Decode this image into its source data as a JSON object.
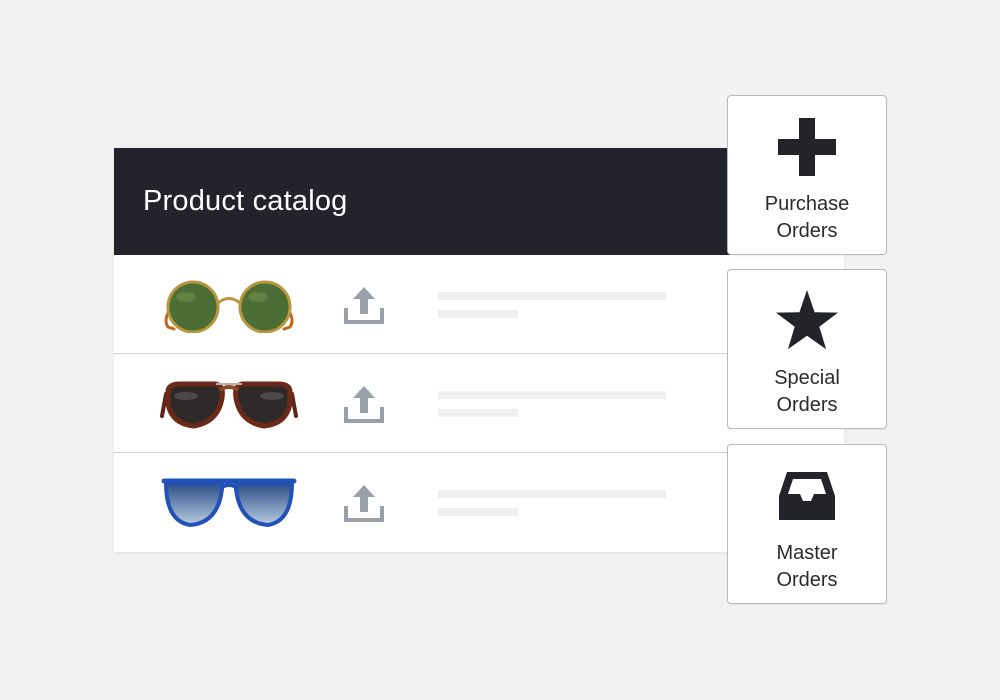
{
  "catalog": {
    "title": "Product catalog",
    "rows": [
      {
        "product_icon": "round-green-sunglasses-icon",
        "action_icon": "upload-icon"
      },
      {
        "product_icon": "tortoise-aviator-sunglasses-icon",
        "action_icon": "upload-icon"
      },
      {
        "product_icon": "blue-frame-sunglasses-icon",
        "action_icon": "upload-icon"
      }
    ]
  },
  "actions": [
    {
      "icon": "plus-icon",
      "label_line1": "Purchase",
      "label_line2": "Orders"
    },
    {
      "icon": "star-icon",
      "label_line1": "Special",
      "label_line2": "Orders"
    },
    {
      "icon": "inbox-tray-icon",
      "label_line1": "Master",
      "label_line2": "Orders"
    }
  ],
  "colors": {
    "header_bg": "#22232b",
    "background": "#f2f2f2",
    "icon_dark": "#23242a",
    "upload_icon": "#9aa0a8",
    "placeholder_line": "#efeff0"
  }
}
